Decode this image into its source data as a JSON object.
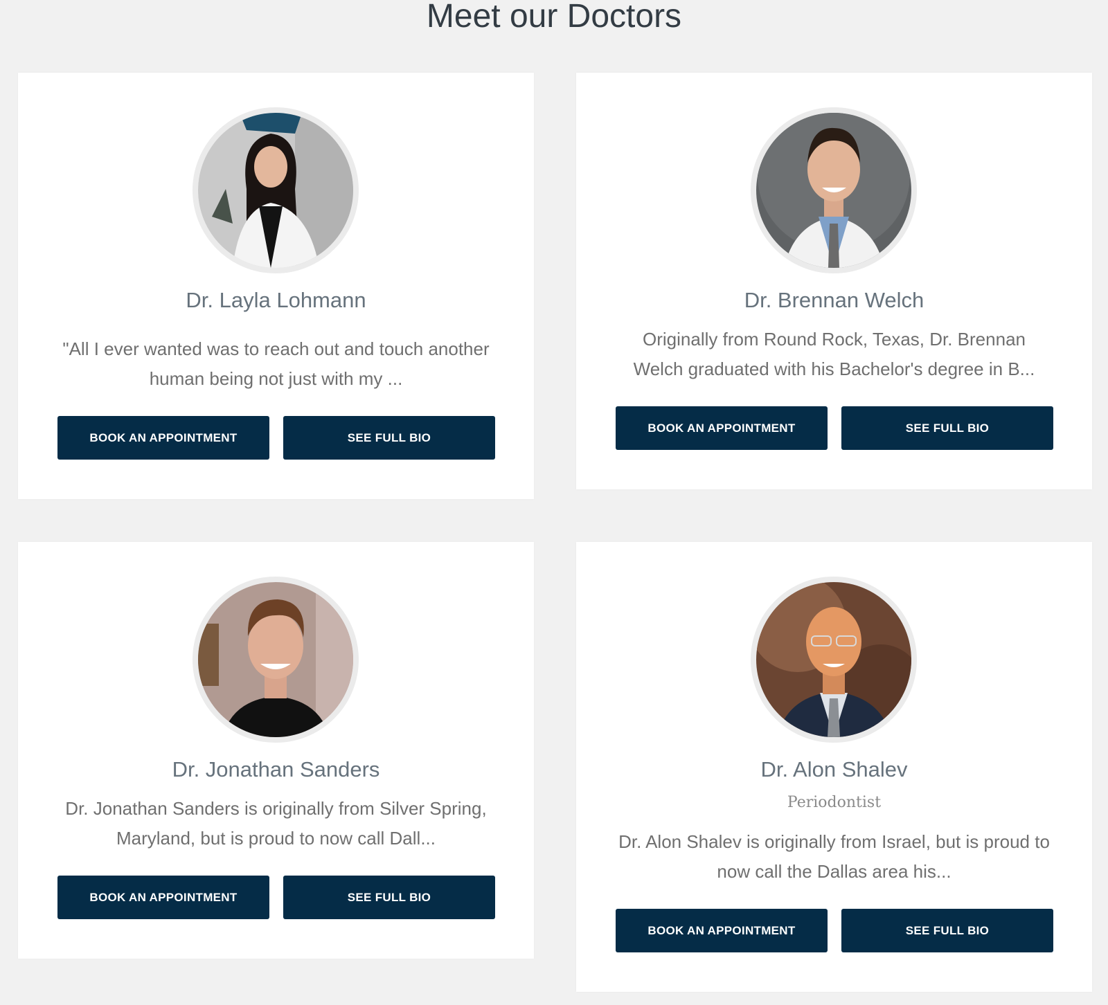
{
  "page": {
    "title": "Meet our Doctors"
  },
  "doctors": [
    {
      "name": "Dr. Layla Lohmann",
      "role": "",
      "bio": "\"All I ever wanted was to reach out and touch another human being not just with my ...",
      "book_label": "BOOK AN APPOINTMENT",
      "bio_label": "SEE FULL BIO"
    },
    {
      "name": "Dr. Brennan Welch",
      "role": "",
      "bio": "Originally from Round Rock, Texas, Dr. Brennan Welch graduated with his Bachelor's degree in B...",
      "book_label": "BOOK AN APPOINTMENT",
      "bio_label": "SEE FULL BIO"
    },
    {
      "name": "Dr. Jonathan Sanders",
      "role": "",
      "bio": "Dr. Jonathan Sanders is originally from Silver Spring, Maryland, but is proud to now call Dall...",
      "book_label": "BOOK AN APPOINTMENT",
      "bio_label": "SEE FULL BIO"
    },
    {
      "name": "Dr. Alon Shalev",
      "role": "Periodontist",
      "bio": "Dr. Alon Shalev is originally from Israel, but is proud to now call the Dallas area his...",
      "book_label": "BOOK AN APPOINTMENT",
      "bio_label": "SEE FULL BIO"
    }
  ],
  "colors": {
    "background": "#f1f1f1",
    "card": "#ffffff",
    "button": "#052c47",
    "name": "#66727c"
  }
}
